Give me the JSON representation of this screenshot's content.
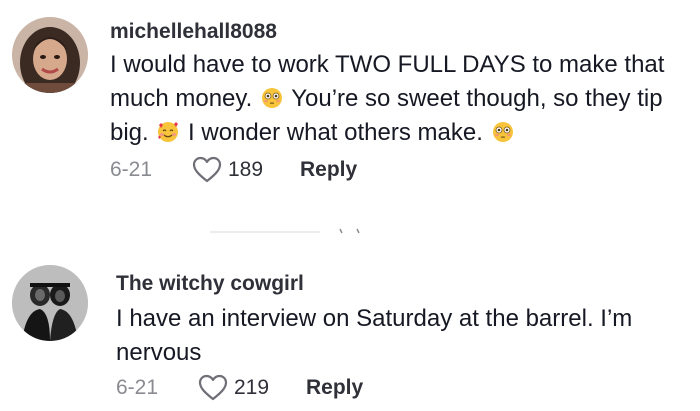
{
  "comments": [
    {
      "username": "michellehall8088",
      "text_lines": [
        "I would have to work TWO FULL DAYS to make that",
        "much money.",
        "You’re so sweet though, so they tip",
        "big.",
        "I wonder what others make."
      ],
      "date": "6-21",
      "likes": "189",
      "reply_label": "Reply",
      "emojis": [
        "flushed-face-emoji",
        "smiling-face-with-hearts-emoji",
        "flushed-face-emoji"
      ]
    },
    {
      "username": "The witchy cowgirl",
      "text_lines": [
        "I have an interview on Saturday at the barrel. I’m",
        "nervous"
      ],
      "date": "6-21",
      "likes": "219",
      "reply_label": "Reply"
    }
  ],
  "icons": {
    "like": "heart-outline-icon"
  },
  "colors": {
    "text": "#161823",
    "username": "#2f3038",
    "meta": "#8a8b91"
  }
}
